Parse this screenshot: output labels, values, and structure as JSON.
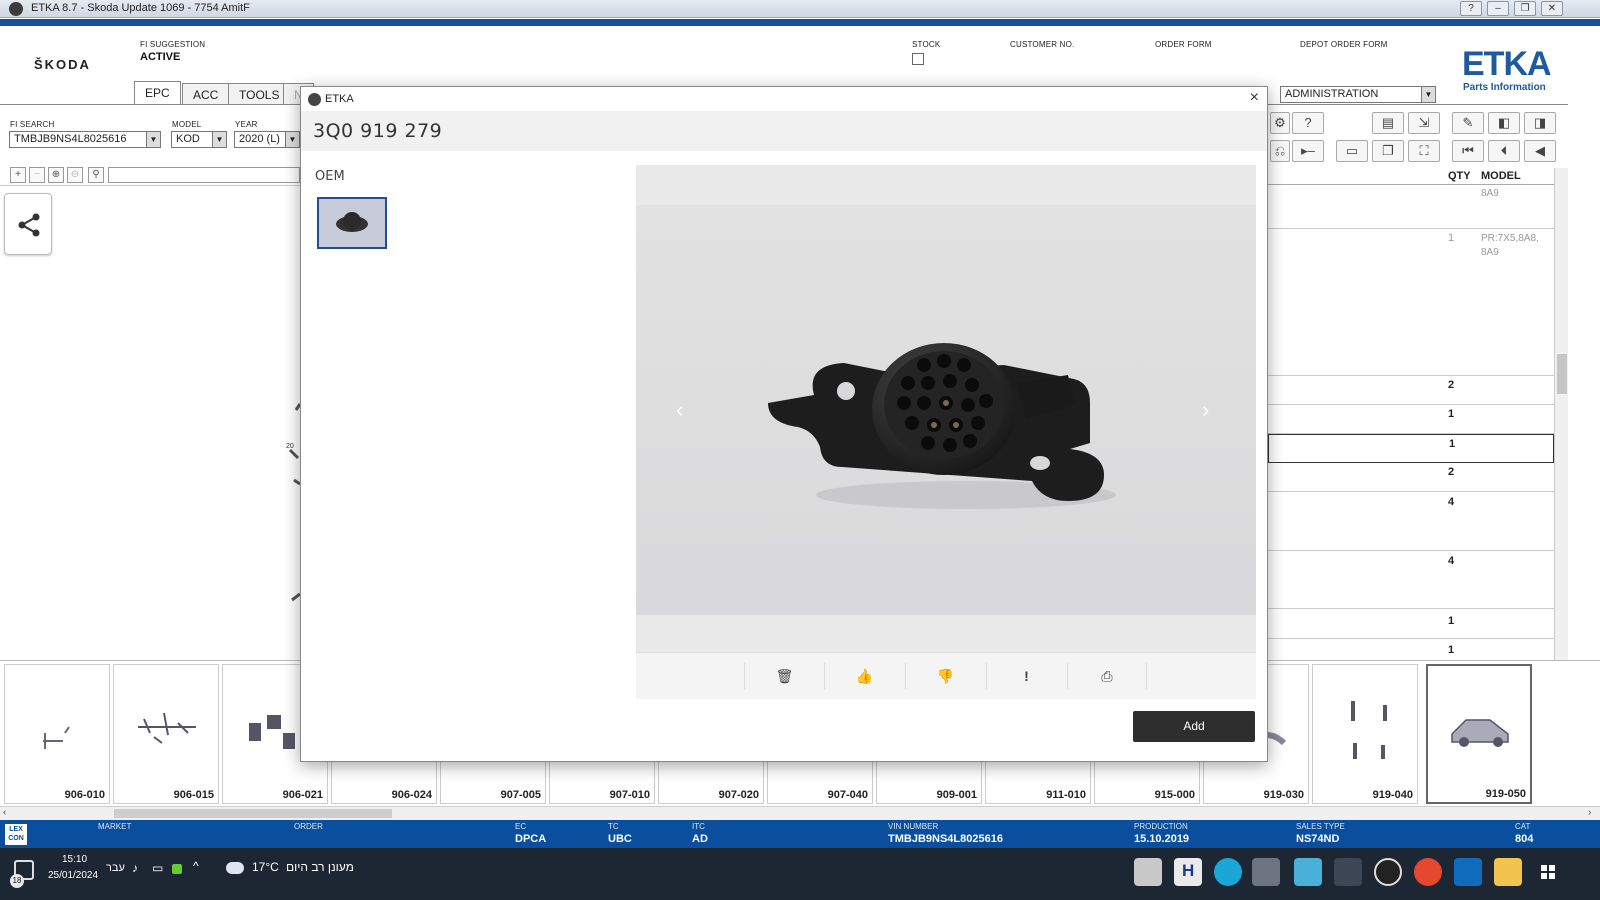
{
  "window": {
    "title": "ETKA 8.7 - Skoda Update 1069 - 7754 AmitF",
    "buttons": [
      "?",
      "–",
      "❐",
      "✕"
    ]
  },
  "header": {
    "brand": "ŠKODA",
    "fi_suggestion_label": "FI SUGGESTION",
    "fi_suggestion_value": "ACTIVE",
    "stock_label": "STOCK",
    "customer_no_label": "CUSTOMER NO.",
    "order_form_label": "ORDER FORM",
    "depot_order_form_label": "DEPOT ORDER FORM",
    "logo": "ETKA",
    "logo_sub": "Parts Information",
    "tabs": [
      "EPC",
      "ACC",
      "TOOLS",
      "N"
    ],
    "admin_value": "ADMINISTRATION",
    "fi_search_label": "FI SEARCH",
    "fi_search_value": "TMBJB9NS4L8025616",
    "model_label": "MODEL",
    "model_value": "KOD",
    "year_label": "YEAR",
    "year_value": "2020 (L)"
  },
  "right_list": {
    "qty_header": "QTY",
    "model_header": "MODEL",
    "rows": [
      {
        "qty": "",
        "model": "8A9"
      },
      {
        "qty": "1",
        "model": "PR:7X5,8A8, 8A9"
      },
      {
        "qty": "2",
        "model": ""
      },
      {
        "qty": "1",
        "model": ""
      },
      {
        "qty": "1",
        "model": ""
      },
      {
        "qty": "2",
        "model": ""
      },
      {
        "qty": "4",
        "model": ""
      },
      {
        "qty": "4",
        "model": ""
      },
      {
        "qty": "1",
        "model": ""
      },
      {
        "qty": "1",
        "model": ""
      }
    ]
  },
  "modal": {
    "title": "ETKA",
    "part_number": "3Q0 919 279",
    "oem_label": "OEM",
    "add_label": "Add",
    "toolbar_icons": [
      "trash-icon",
      "thumbs-up-icon",
      "thumbs-down-icon",
      "exclamation-icon",
      "print-icon"
    ]
  },
  "thumbnails": [
    "906-010",
    "906-015",
    "906-021",
    "906-024",
    "907-005",
    "907-010",
    "907-020",
    "907-040",
    "909-001",
    "911-010",
    "915-000",
    "919-030",
    "919-040",
    "919-050"
  ],
  "status_bar": {
    "lex_con": "LEX CON",
    "market_label": "MARKET",
    "order_label": "ORDER",
    "ec_label": "EC",
    "ec_value": "DPCA",
    "tc_label": "TC",
    "tc_value": "UBC",
    "itc_label": "ITC",
    "itc_value": "AD",
    "vin_label": "VIN NUMBER",
    "vin_value": "TMBJB9NS4L8025616",
    "production_label": "PRODUCTION",
    "production_value": "15.10.2019",
    "sales_type_label": "SALES TYPE",
    "sales_type_value": "NS74ND",
    "cat_label": "CAT",
    "cat_value": "804"
  },
  "taskbar": {
    "time": "15:10",
    "date": "25/01/2024",
    "lang": "עבר",
    "weather_temp": "17°C",
    "weather_text": "מעונן רב היום",
    "notif_count": "18"
  },
  "colors": {
    "status_blue": "#0a4f9e",
    "etka_blue": "#1e5aa0",
    "add_button": "#2e2e2e"
  }
}
